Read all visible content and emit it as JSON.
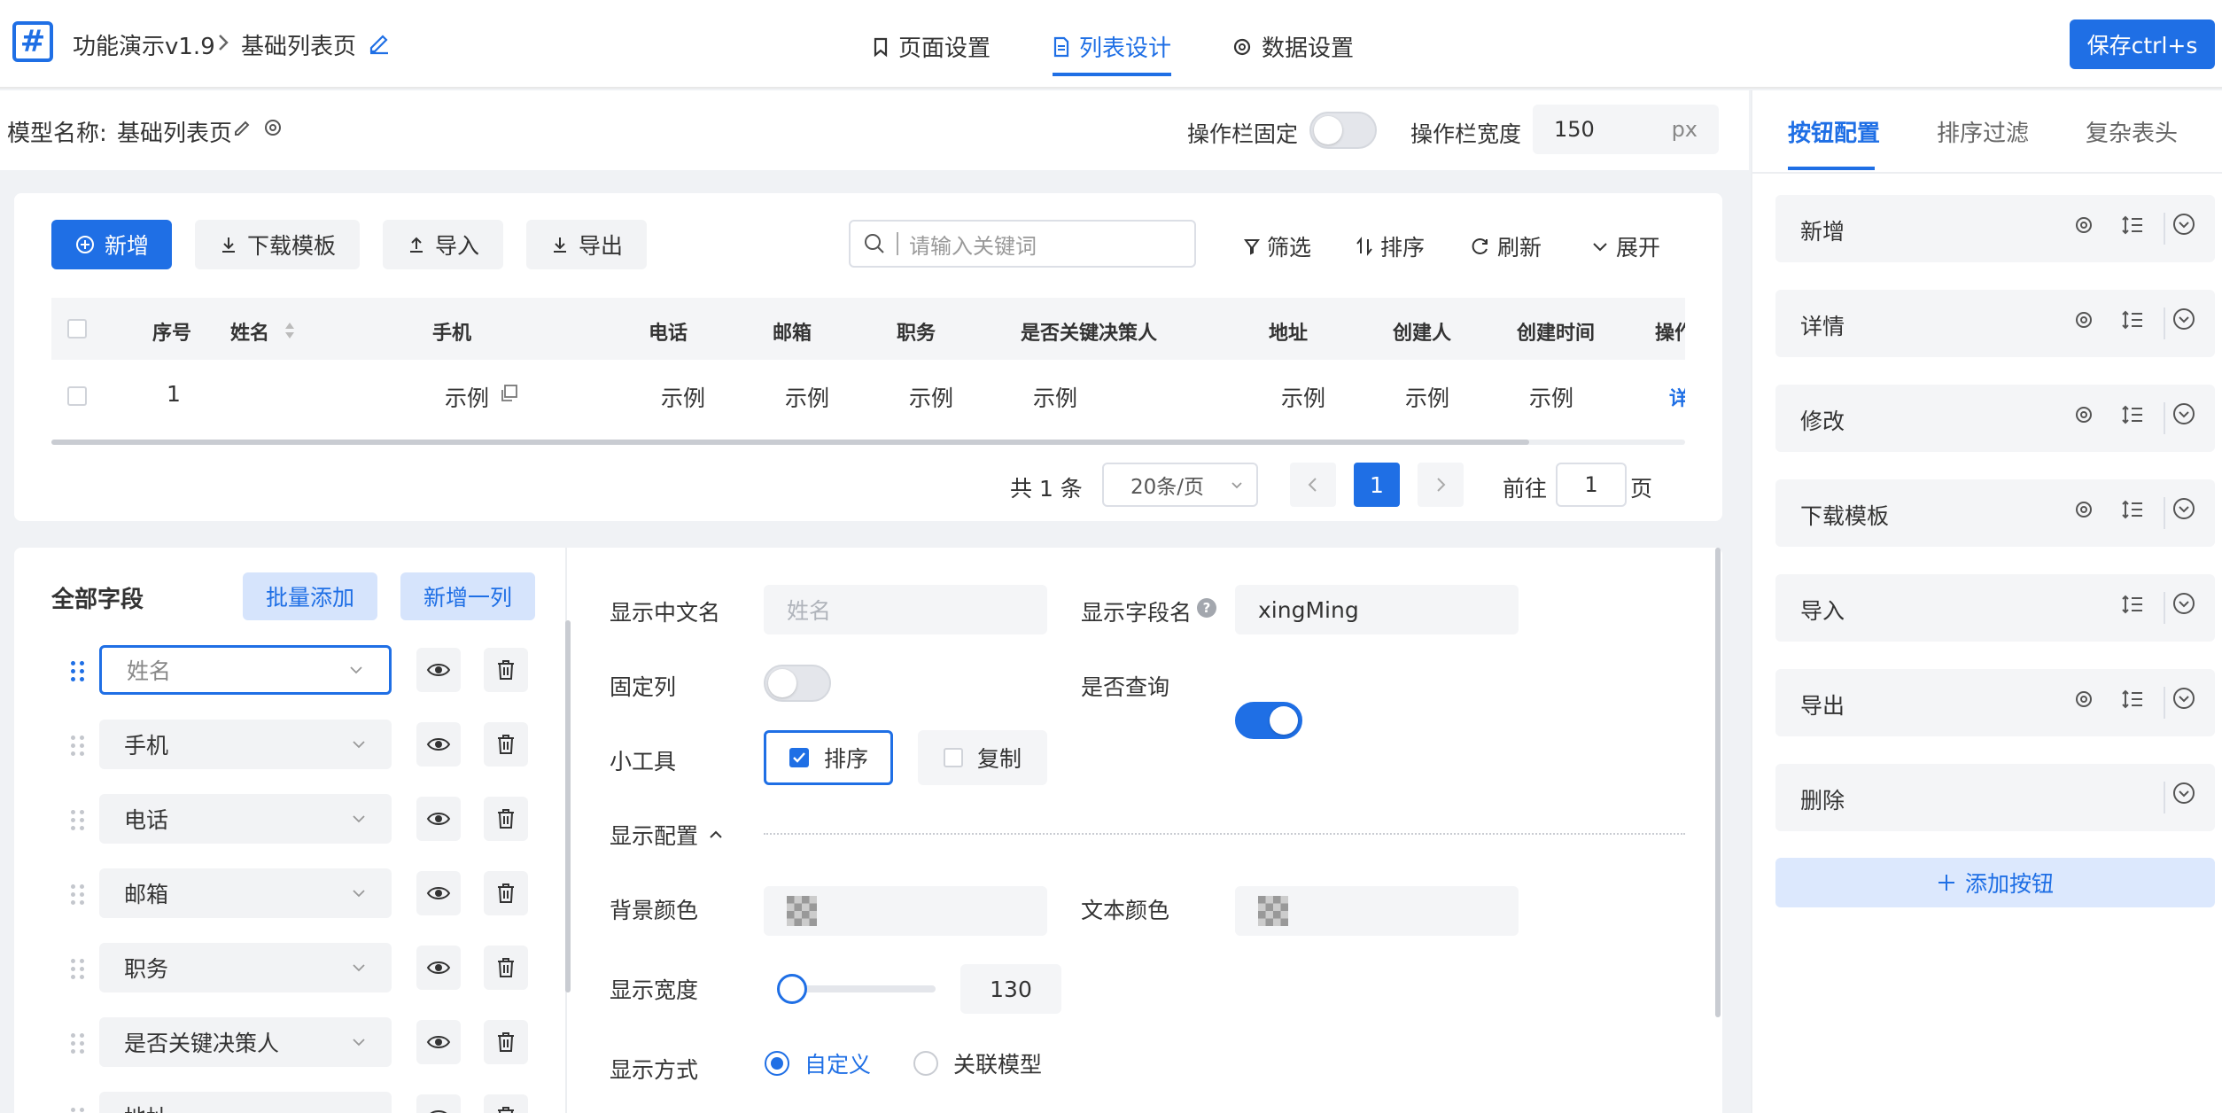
{
  "header": {
    "logo": "#",
    "app_name": "功能演示v1.9",
    "page_name": "基础列表页",
    "tabs": [
      {
        "label": "页面设置"
      },
      {
        "label": "列表设计"
      },
      {
        "label": "数据设置"
      }
    ],
    "save_label": "保存ctrl+s"
  },
  "model": {
    "label": "模型名称:",
    "name": "基础列表页",
    "fixed_label": "操作栏固定",
    "width_label": "操作栏宽度",
    "width_value": "150",
    "width_unit": "px"
  },
  "toolbar": {
    "add": "新增",
    "download": "下载模板",
    "import": "导入",
    "export": "导出",
    "search_placeholder": "请输入关键词",
    "filter": "筛选",
    "sort": "排序",
    "refresh": "刷新",
    "expand": "展开"
  },
  "table": {
    "columns": [
      "序号",
      "姓名",
      "手机",
      "电话",
      "邮箱",
      "职务",
      "是否关键决策人",
      "地址",
      "创建人",
      "创建时间",
      "操作"
    ],
    "rows": [
      {
        "index": "1",
        "name": "",
        "phone": "示例",
        "tel": "示例",
        "email": "示例",
        "title": "示例",
        "decision": "示例",
        "address": "示例",
        "creator": "示例",
        "created": "示例",
        "action": "详情"
      }
    ]
  },
  "pagination": {
    "total": "共 1 条",
    "page_size": "20条/页",
    "current": "1",
    "goto_label": "前往",
    "goto_value": "1",
    "page_unit": "页"
  },
  "fields": {
    "title": "全部字段",
    "batch_add": "批量添加",
    "add_column": "新增一列",
    "items": [
      "姓名",
      "手机",
      "电话",
      "邮箱",
      "职务",
      "是否关键决策人",
      "地址"
    ]
  },
  "form": {
    "cn_name_label": "显示中文名",
    "cn_name_placeholder": "姓名",
    "field_name_label": "显示字段名",
    "field_name_value": "xingMing",
    "fixed_col_label": "固定列",
    "query_label": "是否查询",
    "tools_label": "小工具",
    "tool_sort": "排序",
    "tool_copy": "复制",
    "display_config_label": "显示配置",
    "bg_color_label": "背景颜色",
    "text_color_label": "文本颜色",
    "width_label": "显示宽度",
    "width_value": "130",
    "width_fraction": 0.05,
    "mode_label": "显示方式",
    "mode_custom": "自定义",
    "mode_relation": "关联模型"
  },
  "right": {
    "tabs": [
      "按钮配置",
      "排序过滤",
      "复杂表头"
    ],
    "buttons": [
      "新增",
      "详情",
      "修改",
      "下载模板",
      "导入",
      "导出",
      "删除"
    ],
    "add_button": "添加按钮"
  },
  "colors": {
    "accent": "#1f6fe5"
  }
}
